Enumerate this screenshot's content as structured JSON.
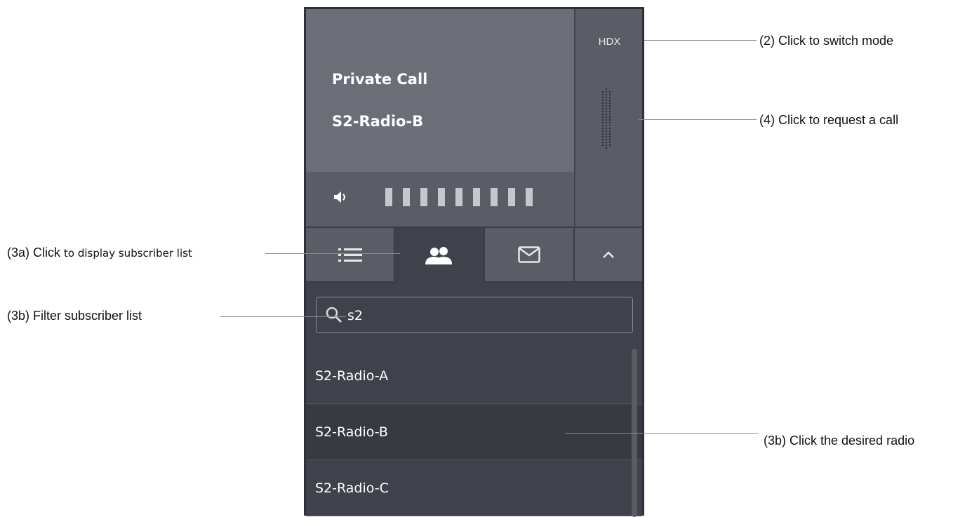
{
  "call_panel": {
    "call_type": "Private Call",
    "call_target": "S2-Radio-B",
    "volume_levels": 9,
    "mode_label": "HDX"
  },
  "tabs": [
    {
      "name": "list-icon",
      "active": false
    },
    {
      "name": "subscribers-icon",
      "active": true
    },
    {
      "name": "mail-icon",
      "active": false
    },
    {
      "name": "chevron-up-icon",
      "active": false
    }
  ],
  "search": {
    "value": "s2"
  },
  "subscribers": [
    {
      "label": "S2-Radio-A",
      "selected": false
    },
    {
      "label": "S2-Radio-B",
      "selected": true
    },
    {
      "label": "S2-Radio-C",
      "selected": false
    }
  ],
  "annotations": {
    "switch_mode": "(2) Click to switch mode",
    "request_call": "(4) Click to request a call",
    "display_list_prefix": "(3a) Click ",
    "display_list_suffix": "to display subscriber list",
    "filter_list": "(3b) Filter subscriber list",
    "click_radio": "(3b) Click the desired radio"
  },
  "colors": {
    "panel_bg": "#3f424b",
    "call_area": "#6b6d77",
    "secondary": "#5b5d66",
    "text": "#ffffff"
  }
}
